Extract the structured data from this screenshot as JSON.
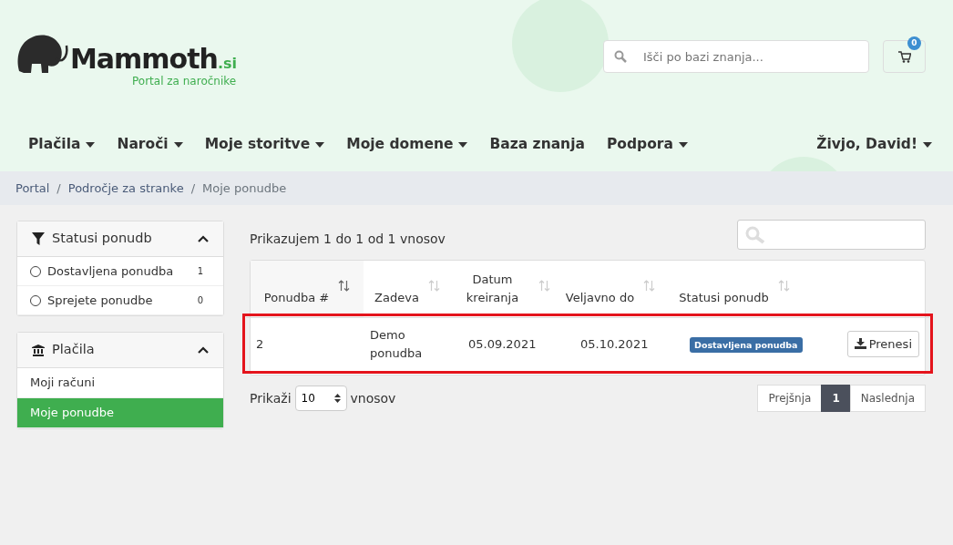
{
  "logo": {
    "name": "Mammoth",
    "suffix": ".si",
    "tagline": "Portal za naročnike"
  },
  "search": {
    "placeholder": "Išči po bazi znanja..."
  },
  "cart": {
    "count": "0"
  },
  "nav": [
    {
      "label": "Plačila",
      "dropdown": true
    },
    {
      "label": "Naroči",
      "dropdown": true
    },
    {
      "label": "Moje storitve",
      "dropdown": true
    },
    {
      "label": "Moje domene",
      "dropdown": true
    },
    {
      "label": "Baza znanja",
      "dropdown": false
    },
    {
      "label": "Podpora",
      "dropdown": true
    }
  ],
  "user_menu": {
    "label": "Živjo, David!"
  },
  "breadcrumb": {
    "separator": "/",
    "items": [
      "Portal",
      "Področje za stranke",
      "Moje ponudbe"
    ]
  },
  "sidebar": [
    {
      "title": "Statusi ponudb",
      "items": [
        {
          "kind": "radio",
          "label": "Dostavljena ponudba",
          "count": "1",
          "selected": false
        },
        {
          "kind": "radio",
          "label": "Sprejete ponudbe",
          "count": "0",
          "selected": false
        }
      ]
    },
    {
      "title": "Plačila",
      "items": [
        {
          "kind": "link",
          "label": "Moji računi",
          "selected": false
        },
        {
          "kind": "link",
          "label": "Moje ponudbe",
          "selected": true
        }
      ]
    }
  ],
  "table": {
    "info": "Prikazujem 1 do 1 od 1 vnosov",
    "columns": [
      {
        "label": "Ponudba #",
        "sorted": true
      },
      {
        "label": "Zadeva",
        "sorted": false
      },
      {
        "label": "Datum kreiranja",
        "sorted": false
      },
      {
        "label": "Veljavno do",
        "sorted": false
      },
      {
        "label": "Statusi ponudb",
        "sorted": false
      }
    ],
    "rows": [
      {
        "number": "2",
        "subject": "Demo ponudba",
        "created": "05.09.2021",
        "valid_until": "05.10.2021",
        "status": "Dostavljena ponudba",
        "action": "Prenesi",
        "highlighted": true
      }
    ],
    "length_label": "Prikaži",
    "length_value": "10",
    "length_suffix": "vnosov",
    "pagination": [
      {
        "label": "Prejšnja",
        "selected": false
      },
      {
        "label": "1",
        "selected": true
      },
      {
        "label": "Naslednja",
        "selected": false
      }
    ]
  }
}
